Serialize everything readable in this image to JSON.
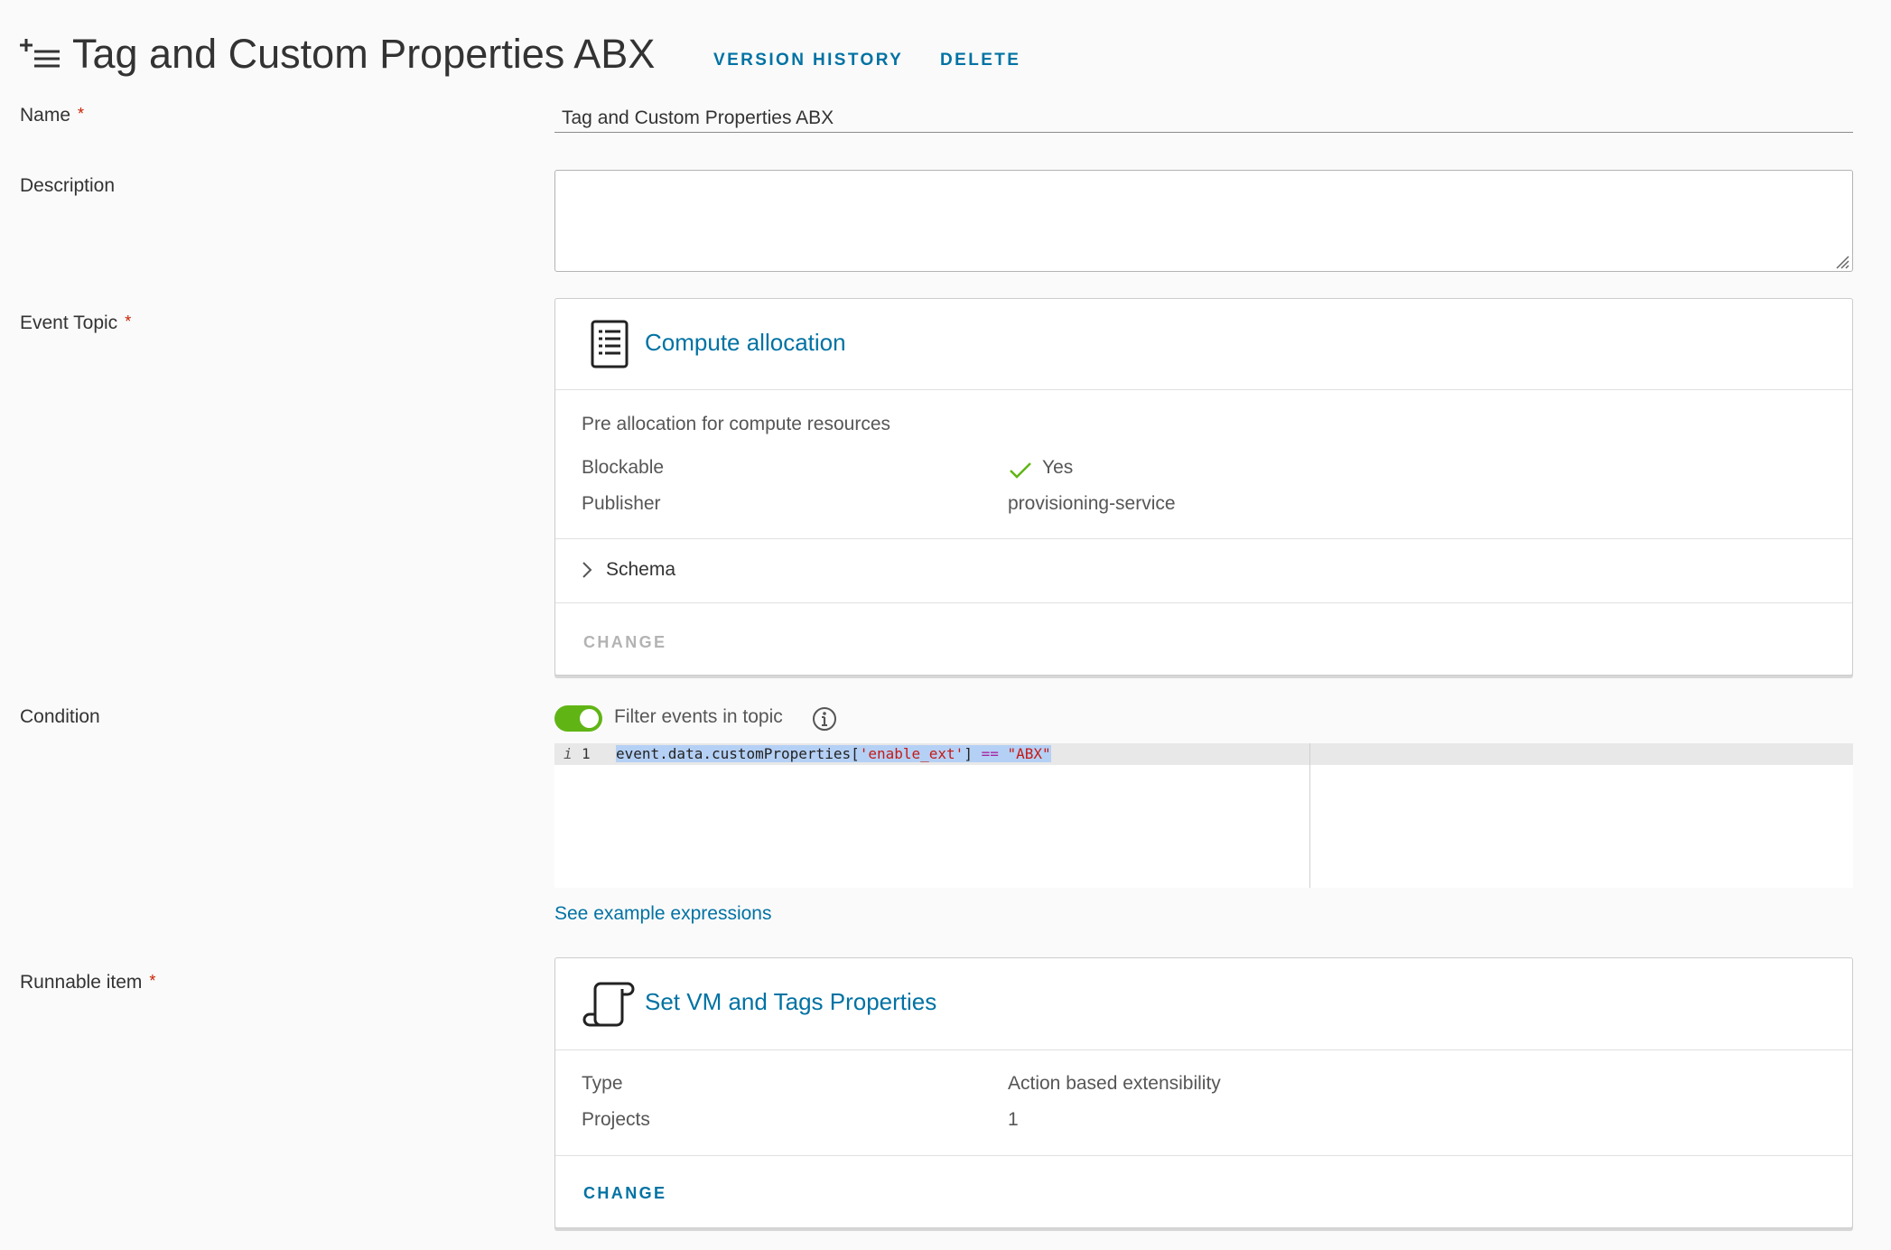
{
  "header": {
    "title": "Tag and Custom Properties ABX",
    "version_history_label": "VERSION HISTORY",
    "delete_label": "DELETE"
  },
  "form": {
    "name_label": "Name",
    "name_value": "Tag and Custom Properties ABX",
    "description_label": "Description",
    "description_value": "",
    "event_topic_label": "Event Topic",
    "condition_label": "Condition",
    "runnable_label": "Runnable item",
    "required_mark": "*"
  },
  "event_topic": {
    "title": "Compute allocation",
    "description": "Pre allocation for compute resources",
    "blockable_key": "Blockable",
    "blockable_value": "Yes",
    "publisher_key": "Publisher",
    "publisher_value": "provisioning-service",
    "schema_label": "Schema",
    "change_label": "CHANGE",
    "change_enabled": false
  },
  "condition": {
    "toggle_on": true,
    "toggle_label": "Filter events in topic",
    "line_marker": "i",
    "line_number": "1",
    "code_part1": "event.data.customProperties[",
    "code_string1": "'enable_ext'",
    "code_part2": "] ",
    "code_operator": "==",
    "code_space": " ",
    "code_string2": "\"ABX\"",
    "example_link": "See example expressions"
  },
  "runnable": {
    "title": "Set VM and Tags Properties",
    "type_key": "Type",
    "type_value": "Action based extensibility",
    "projects_key": "Projects",
    "projects_value": "1",
    "change_label": "CHANGE",
    "change_enabled": true
  },
  "colors": {
    "accent": "#0072a3",
    "required": "#c92100",
    "toggle_on": "#60b515",
    "check": "#60b515",
    "disabled": "#b3b3b3",
    "code_string": "#c41a16",
    "code_operator": "#a626a4",
    "selection": "#b5d0f5"
  },
  "icons": {
    "header": "add-list-icon",
    "event_topic": "document-list-icon",
    "runnable": "script-scroll-icon",
    "blockable": "check-icon",
    "schema": "chevron-right-icon",
    "info": "info-icon"
  }
}
